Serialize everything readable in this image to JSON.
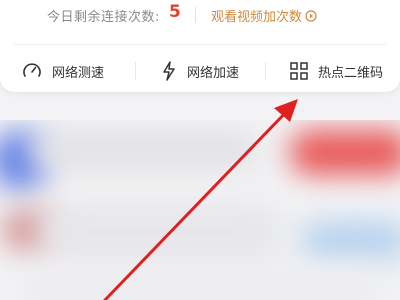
{
  "status": {
    "remaining_label": "今日剩余连接次数:",
    "remaining_count": "5",
    "watch_video_label": "观看视频加次数"
  },
  "tools": [
    {
      "label": "网络测速",
      "icon": "speedometer-icon"
    },
    {
      "label": "网络加速",
      "icon": "lightning-icon"
    },
    {
      "label": "热点二维码",
      "icon": "qr-code-icon"
    }
  ],
  "colors": {
    "accent_orange": "#d08a3c",
    "count_red": "#e0412f",
    "annotation_arrow": "#e02020"
  }
}
